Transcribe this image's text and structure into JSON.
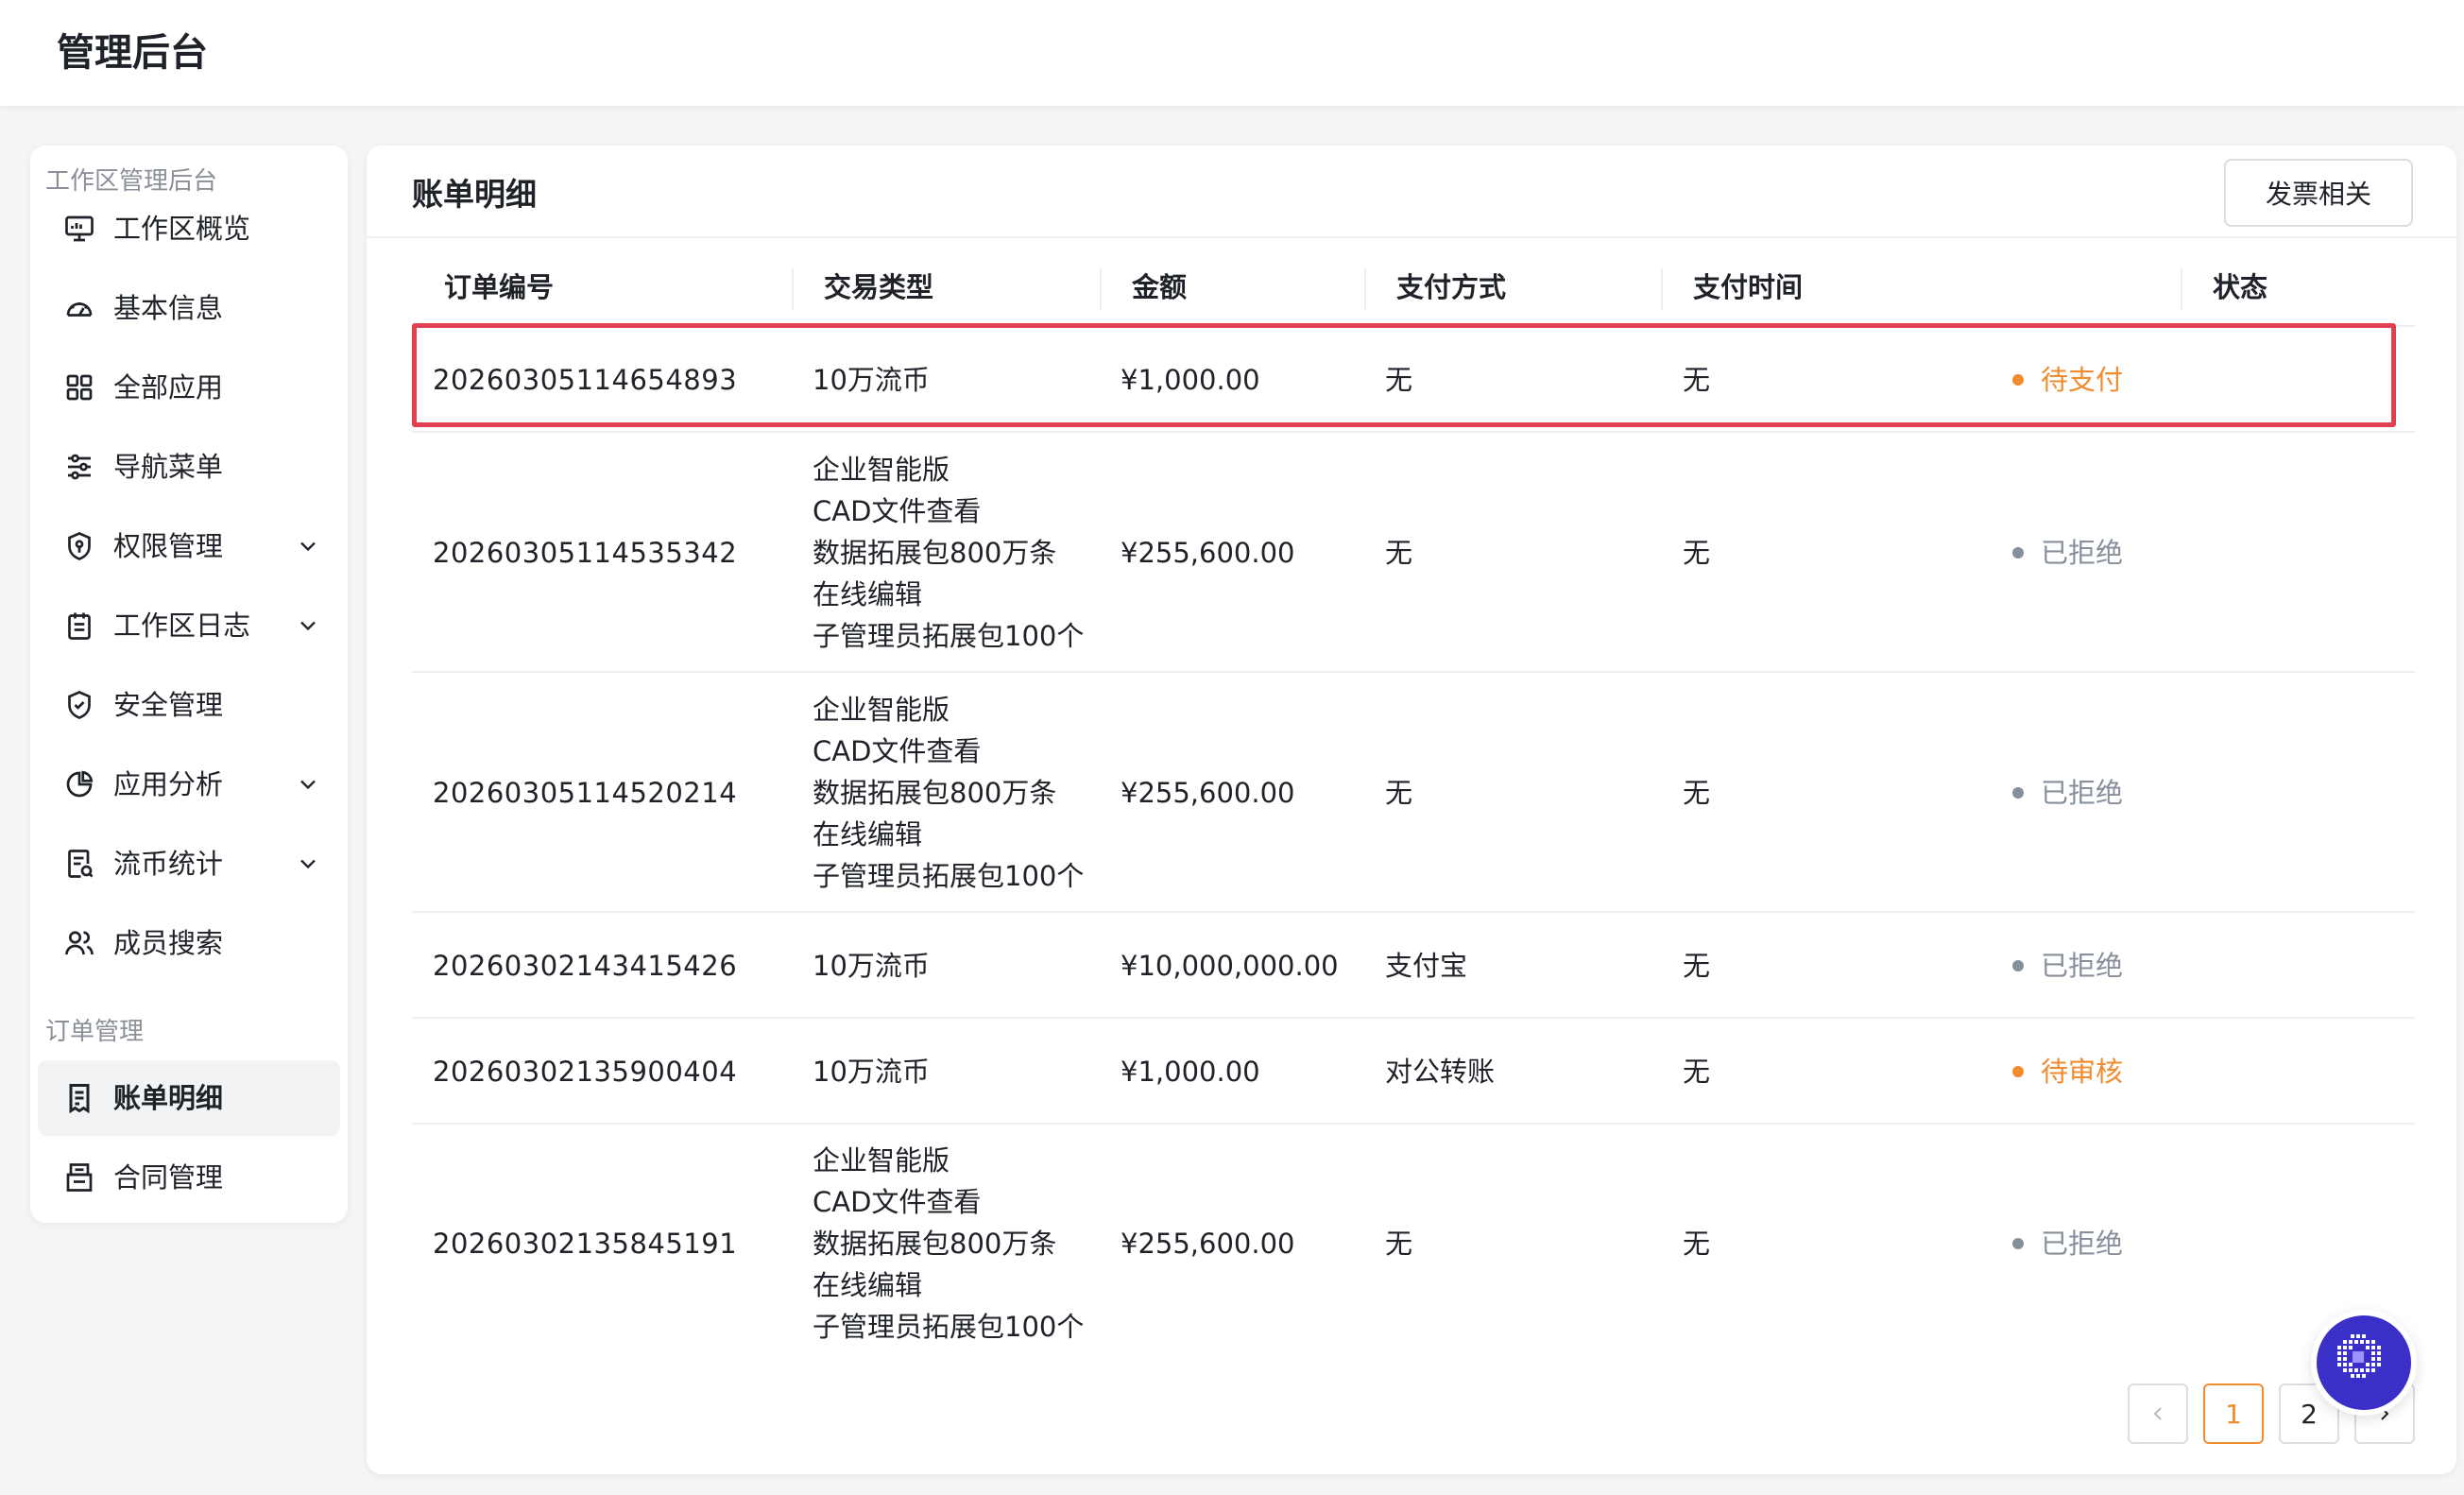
{
  "app": {
    "title": "管理后台"
  },
  "colors": {
    "accent": "#f08c2e",
    "pending": "#f08c2e",
    "rejected": "#86909c",
    "highlight": "#e0404f",
    "assistant": "#3a2fc7"
  },
  "sidebar": {
    "section_workspace": "工作区管理后台",
    "section_orders": "订单管理",
    "items": [
      {
        "label": "工作区概览",
        "icon": "monitor-icon"
      },
      {
        "label": "基本信息",
        "icon": "dashboard-icon"
      },
      {
        "label": "全部应用",
        "icon": "grid-icon"
      },
      {
        "label": "导航菜单",
        "icon": "sliders-icon"
      },
      {
        "label": "权限管理",
        "icon": "shield-key-icon",
        "expandable": true
      },
      {
        "label": "工作区日志",
        "icon": "calendar-icon",
        "expandable": true
      },
      {
        "label": "安全管理",
        "icon": "shield-check-icon"
      },
      {
        "label": "应用分析",
        "icon": "pie-chart-icon",
        "expandable": true
      },
      {
        "label": "流币统计",
        "icon": "report-icon",
        "expandable": true
      },
      {
        "label": "成员搜索",
        "icon": "users-icon"
      },
      {
        "label": "账单明细",
        "icon": "bill-icon",
        "active": true
      },
      {
        "label": "合同管理",
        "icon": "contract-icon"
      }
    ]
  },
  "main": {
    "title": "账单明细",
    "invoice_button": "发票相关",
    "columns": [
      "订单编号",
      "交易类型",
      "金额",
      "支付方式",
      "支付时间",
      "状态"
    ],
    "rows": [
      {
        "order": "20260305114654893",
        "types": [
          "10万流币"
        ],
        "amount": "¥1,000.00",
        "pay": "无",
        "time": "无",
        "status": "待支付",
        "status_kind": "pending"
      },
      {
        "order": "20260305114535342",
        "types": [
          "企业智能版",
          "CAD文件查看",
          "数据拓展包800万条",
          "在线编辑",
          "子管理员拓展包100个"
        ],
        "amount": "¥255,600.00",
        "pay": "无",
        "time": "无",
        "status": "已拒绝",
        "status_kind": "rejected"
      },
      {
        "order": "20260305114520214",
        "types": [
          "企业智能版",
          "CAD文件查看",
          "数据拓展包800万条",
          "在线编辑",
          "子管理员拓展包100个"
        ],
        "amount": "¥255,600.00",
        "pay": "无",
        "time": "无",
        "status": "已拒绝",
        "status_kind": "rejected"
      },
      {
        "order": "20260302143415426",
        "types": [
          "10万流币"
        ],
        "amount": "¥10,000,000.00",
        "pay": "支付宝",
        "time": "无",
        "status": "已拒绝",
        "status_kind": "rejected"
      },
      {
        "order": "20260302135900404",
        "types": [
          "10万流币"
        ],
        "amount": "¥1,000.00",
        "pay": "对公转账",
        "time": "无",
        "status": "待审核",
        "status_kind": "pending"
      },
      {
        "order": "20260302135845191",
        "types": [
          "企业智能版",
          "CAD文件查看",
          "数据拓展包800万条",
          "在线编辑",
          "子管理员拓展包100个"
        ],
        "amount": "¥255,600.00",
        "pay": "无",
        "time": "无",
        "status": "已拒绝",
        "status_kind": "rejected"
      }
    ],
    "pagination": {
      "pages": [
        "1",
        "2"
      ],
      "current": "1"
    }
  }
}
